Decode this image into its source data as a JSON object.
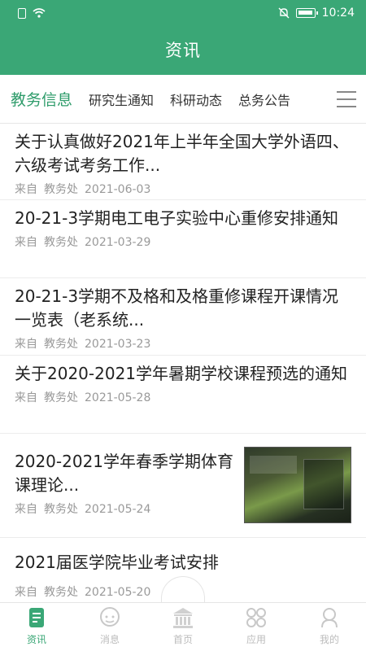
{
  "status_bar": {
    "time": "10:24"
  },
  "header": {
    "title": "资讯"
  },
  "tabs": [
    {
      "label": "教务信息",
      "active": true
    },
    {
      "label": "研究生通知"
    },
    {
      "label": "科研动态"
    },
    {
      "label": "总务公告"
    }
  ],
  "news": [
    {
      "title": "关于认真做好2021年上半年全国大学外语四、六级考试考务工作...",
      "source_prefix": "来自",
      "source": "教务处",
      "date": "2021-06-03"
    },
    {
      "title": "20-21-3学期电工电子实验中心重修安排通知",
      "source_prefix": "来自",
      "source": "教务处",
      "date": "2021-03-29"
    },
    {
      "title": "20-21-3学期不及格和及格重修课程开课情况一览表（老系统...",
      "source_prefix": "来自",
      "source": "教务处",
      "date": "2021-03-23"
    },
    {
      "title": "关于2020-2021学年暑期学校课程预选的通知",
      "source_prefix": "来自",
      "source": "教务处",
      "date": "2021-05-28"
    },
    {
      "title": "2020-2021学年春季学期体育课理论...",
      "source_prefix": "来自",
      "source": "教务处",
      "date": "2021-05-24",
      "has_thumbnail": true
    },
    {
      "title": "2021届医学院毕业考试安排",
      "source_prefix": "来自",
      "source": "教务处",
      "date": "2021-05-20"
    }
  ],
  "bottom_nav": [
    {
      "label": "资讯",
      "icon": "document-icon",
      "active": true
    },
    {
      "label": "消息",
      "icon": "chat-icon"
    },
    {
      "label": "首页",
      "icon": "building-icon"
    },
    {
      "label": "应用",
      "icon": "apps-icon"
    },
    {
      "label": "我的",
      "icon": "user-icon"
    }
  ],
  "colors": {
    "primary": "#3aa776",
    "inactive": "#bcbcbc"
  }
}
